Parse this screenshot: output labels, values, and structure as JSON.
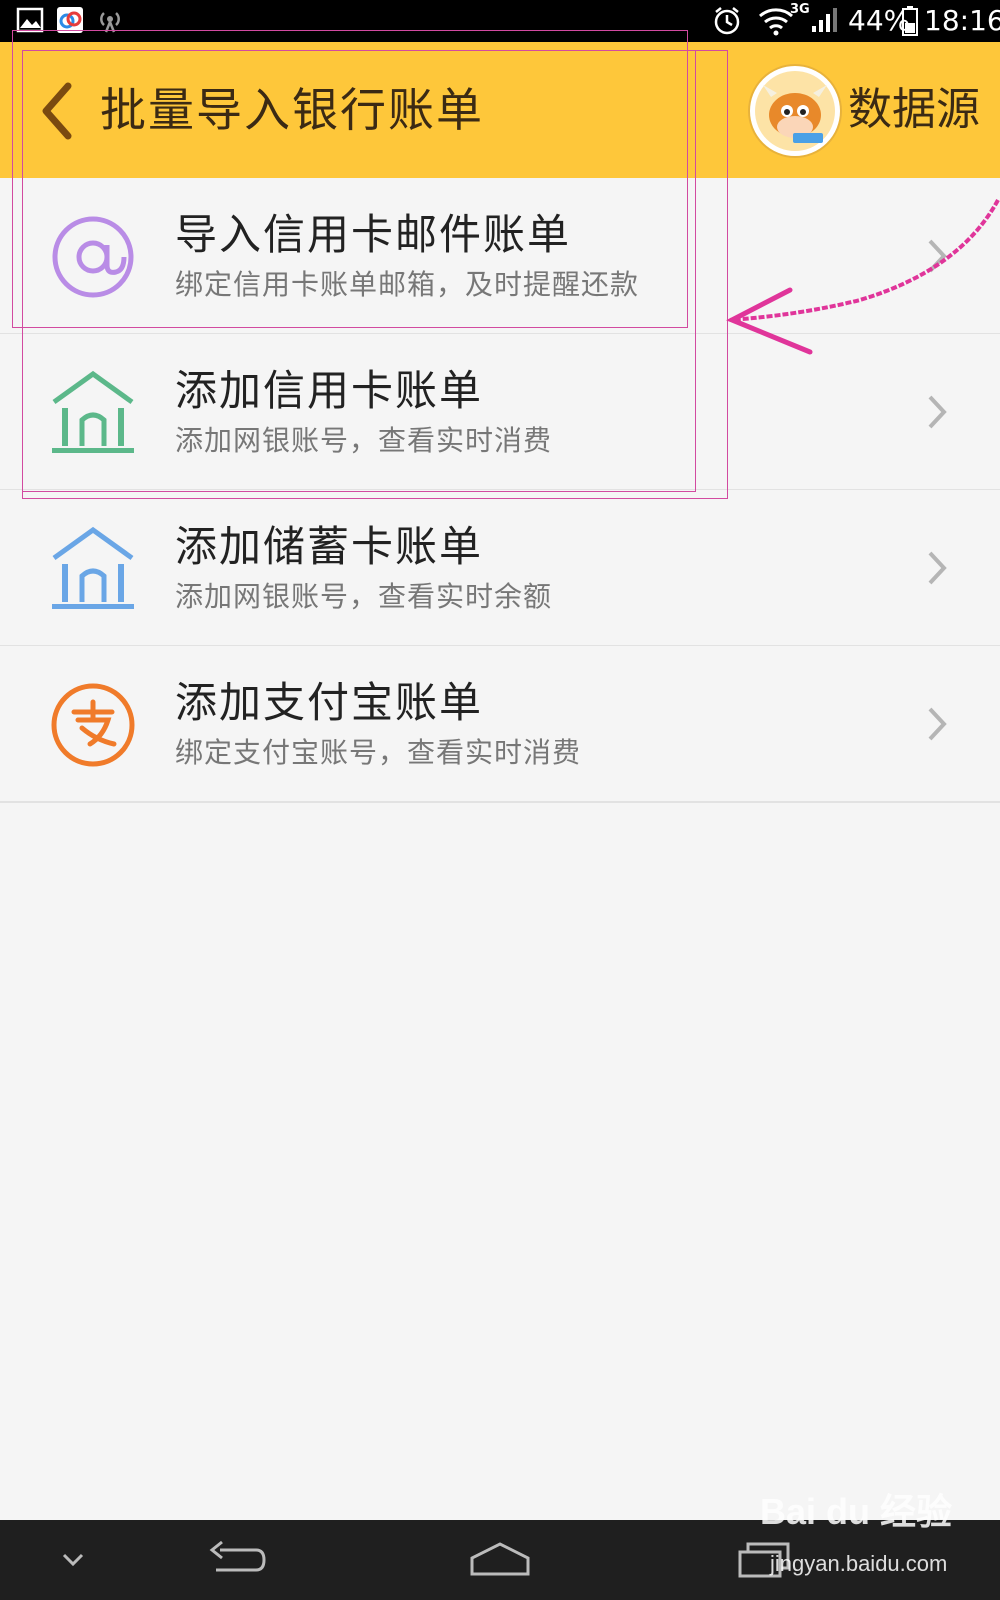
{
  "status_bar": {
    "battery": "44%",
    "time": "18:16",
    "network": "3G",
    "icons": [
      "gallery-icon",
      "baidu-cloud-icon",
      "hotspot-icon",
      "alarm-icon",
      "wifi-icon",
      "signal-icon",
      "battery-icon"
    ]
  },
  "header": {
    "back_icon": "chevron-left-icon",
    "title": "批量导入银行账单",
    "data_source_label": "数据源",
    "background": "#fec73a"
  },
  "items": [
    {
      "icon": "at-sign-icon",
      "icon_color": "#b98ce6",
      "title": "导入信用卡邮件账单",
      "subtitle": "绑定信用卡账单邮箱，及时提醒还款"
    },
    {
      "icon": "bank-icon",
      "icon_color": "#5cb88a",
      "title": "添加信用卡账单",
      "subtitle": "添加网银账号，查看实时消费"
    },
    {
      "icon": "bank-icon",
      "icon_color": "#6aa6e6",
      "title": "添加储蓄卡账单",
      "subtitle": "添加网银账号，查看实时余额"
    },
    {
      "icon": "alipay-icon",
      "icon_color": "#f07b2a",
      "title": "添加支付宝账单",
      "subtitle": "绑定支付宝账号，查看实时消费"
    }
  ],
  "nav_bar": {
    "buttons": [
      "collapse-icon",
      "back-icon",
      "home-icon",
      "recents-icon"
    ]
  },
  "watermark": {
    "brand": "Bai du 经验",
    "url": "jingyan.baidu.com"
  }
}
